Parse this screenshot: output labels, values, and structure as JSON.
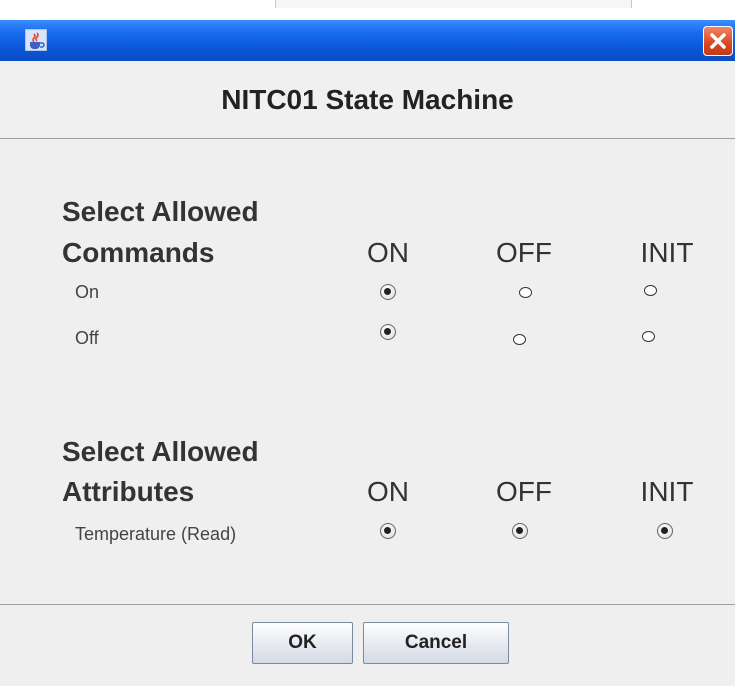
{
  "window": {
    "app_icon": "java-cup-icon",
    "close_icon": "close-x-icon",
    "header_title": "NITC01 State Machine"
  },
  "commands_section": {
    "title_line1": "Select Allowed",
    "title_line2": "Commands",
    "columns": [
      "ON",
      "OFF",
      "INIT"
    ],
    "rows": [
      {
        "label": "On",
        "selected": [
          true,
          false,
          false
        ]
      },
      {
        "label": "Off",
        "selected": [
          true,
          false,
          false
        ]
      }
    ]
  },
  "attributes_section": {
    "title_line1": "Select Allowed",
    "title_line2": "Attributes",
    "columns": [
      "ON",
      "OFF",
      "INIT"
    ],
    "rows": [
      {
        "label": "Temperature (Read)",
        "selected": [
          true,
          true,
          true
        ]
      }
    ]
  },
  "buttons": {
    "ok": "OK",
    "cancel": "Cancel"
  }
}
